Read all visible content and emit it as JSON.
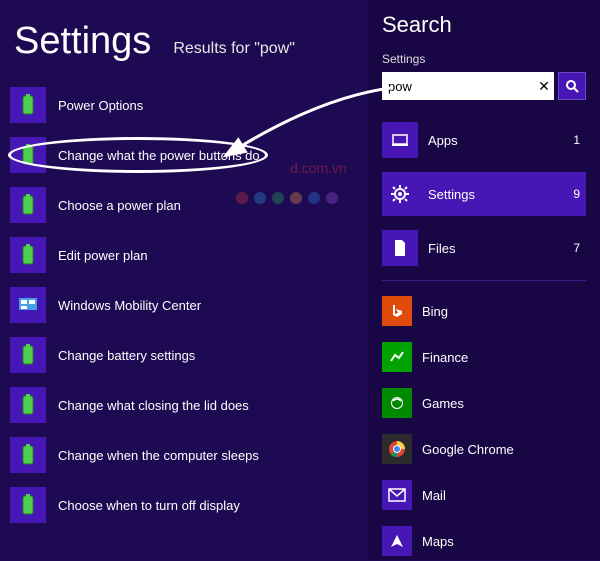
{
  "left": {
    "title": "Settings",
    "results_for": "Results for \"pow\"",
    "items": [
      {
        "label": "Power Options",
        "icon": "power-options"
      },
      {
        "label": "Change what the power buttons do",
        "icon": "power-buttons"
      },
      {
        "label": "Choose a power plan",
        "icon": "power-plan"
      },
      {
        "label": "Edit power plan",
        "icon": "edit-plan"
      },
      {
        "label": "Windows Mobility Center",
        "icon": "mobility"
      },
      {
        "label": "Change battery settings",
        "icon": "battery"
      },
      {
        "label": "Change what closing the lid does",
        "icon": "lid"
      },
      {
        "label": "Change when the computer sleeps",
        "icon": "sleep"
      },
      {
        "label": "Choose when to turn off display",
        "icon": "display-off"
      }
    ]
  },
  "right": {
    "search_title": "Search",
    "subtitle": "Settings",
    "query": "pow",
    "scopes": [
      {
        "label": "Apps",
        "count": "1",
        "selected": false
      },
      {
        "label": "Settings",
        "count": "9",
        "selected": true
      },
      {
        "label": "Files",
        "count": "7",
        "selected": false
      }
    ],
    "apps": [
      {
        "label": "Bing",
        "cls": "bing"
      },
      {
        "label": "Finance",
        "cls": "finance"
      },
      {
        "label": "Games",
        "cls": "games"
      },
      {
        "label": "Google Chrome",
        "cls": "chrome"
      },
      {
        "label": "Mail",
        "cls": "mail"
      },
      {
        "label": "Maps",
        "cls": "maps"
      }
    ]
  },
  "watermark": {
    "text": "d.com.vn"
  }
}
